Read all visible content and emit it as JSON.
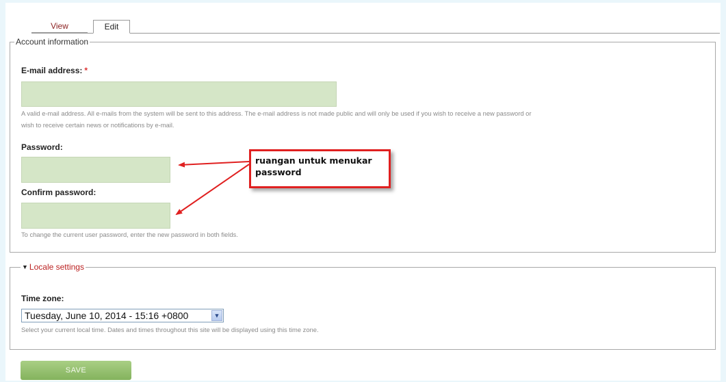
{
  "tabs": {
    "view": "View",
    "edit": "Edit"
  },
  "account": {
    "legend": "Account information",
    "email_label": "E-mail address:",
    "required_mark": "*",
    "email_value": "",
    "email_desc_1": "A valid e-mail address. All e-mails from the system will be sent to this address. The e-mail address is not made public and will only be used if you wish to receive a new password or",
    "email_desc_2": "wish to receive certain news or notifications by e-mail.",
    "password_label": "Password:",
    "confirm_label": "Confirm password:",
    "password_desc": "To change the current user password, enter the new password in both fields."
  },
  "annotation": {
    "line1": "ruangan untuk menukar",
    "line2": "password"
  },
  "locale": {
    "legend": "Locale settings",
    "timezone_label": "Time zone:",
    "timezone_value": "Tuesday, June 10, 2014 - 15:16 +0800",
    "timezone_desc": "Select your current local time. Dates and times throughout this site will be displayed using this time zone."
  },
  "save_label": "SAVE",
  "colors": {
    "accent": "#d33333",
    "input_bg": "#d5e6c7",
    "button": "#96c26f"
  }
}
